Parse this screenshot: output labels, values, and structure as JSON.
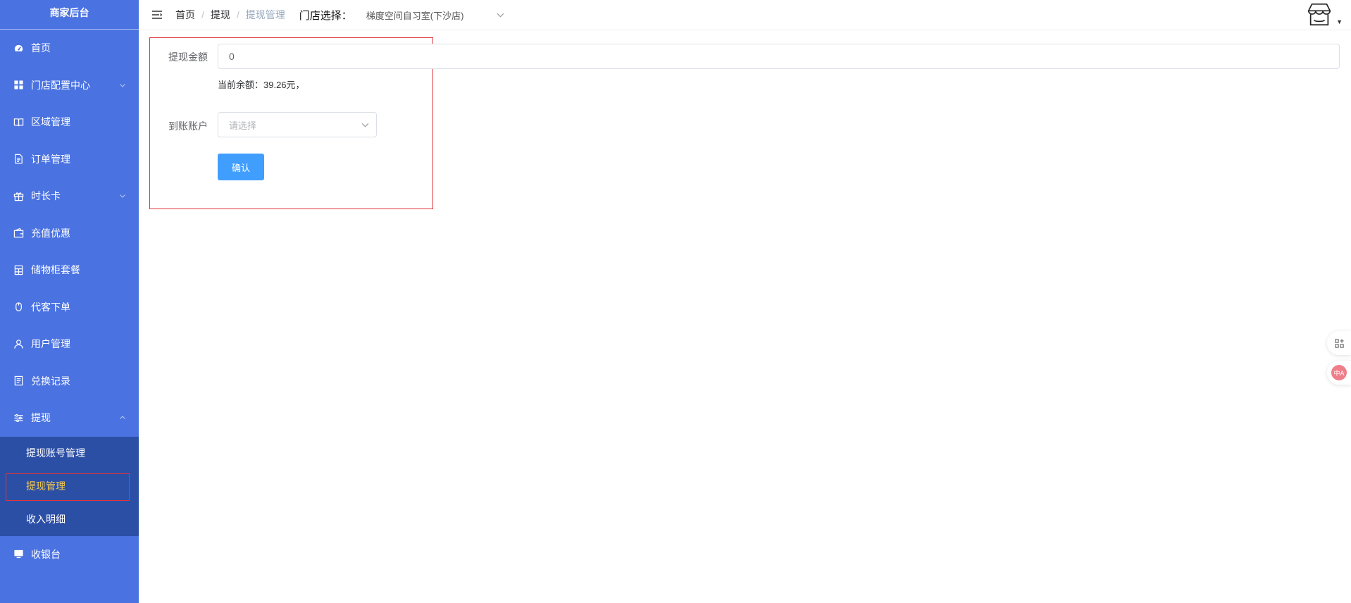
{
  "sidebar": {
    "brand": "商家后台",
    "items": [
      {
        "label": "首页",
        "icon": "dashboard-icon"
      },
      {
        "label": "门店配置中心",
        "icon": "grid-icon"
      },
      {
        "label": "区域管理",
        "icon": "book-icon"
      },
      {
        "label": "订单管理",
        "icon": "document-icon"
      },
      {
        "label": "时长卡",
        "icon": "gift-icon"
      },
      {
        "label": "充值优惠",
        "icon": "wallet-icon"
      },
      {
        "label": "储物柜套餐",
        "icon": "locker-icon"
      },
      {
        "label": "代客下单",
        "icon": "mouse-icon"
      },
      {
        "label": "用户管理",
        "icon": "user-icon"
      },
      {
        "label": "兑换记录",
        "icon": "notes-icon"
      },
      {
        "label": "提现",
        "icon": "sliders-icon"
      }
    ],
    "withdraw_sub": [
      {
        "label": "提现账号管理"
      },
      {
        "label": "提现管理"
      },
      {
        "label": "收入明细"
      }
    ],
    "cashier": {
      "label": "收银台",
      "icon": "monitor-icon"
    }
  },
  "header": {
    "breadcrumb": [
      "首页",
      "提现",
      "提现管理"
    ],
    "store_label": "门店选择：",
    "store_value": "梯度空间自习室(下沙店)"
  },
  "form": {
    "amount_label": "提现金额",
    "amount_value": "0",
    "balance_text": "当前余额：39.26元，",
    "account_label": "到账账户",
    "account_placeholder": "请选择",
    "confirm_label": "确认"
  },
  "floating": {
    "translate_badge": "中A"
  },
  "colors": {
    "sidebar_bg": "#4a72e1",
    "submenu_bg": "#2c4fa6",
    "active_sub_text": "#f5c84a",
    "primary_button": "#409eff",
    "highlight_border": "#e0343a"
  }
}
